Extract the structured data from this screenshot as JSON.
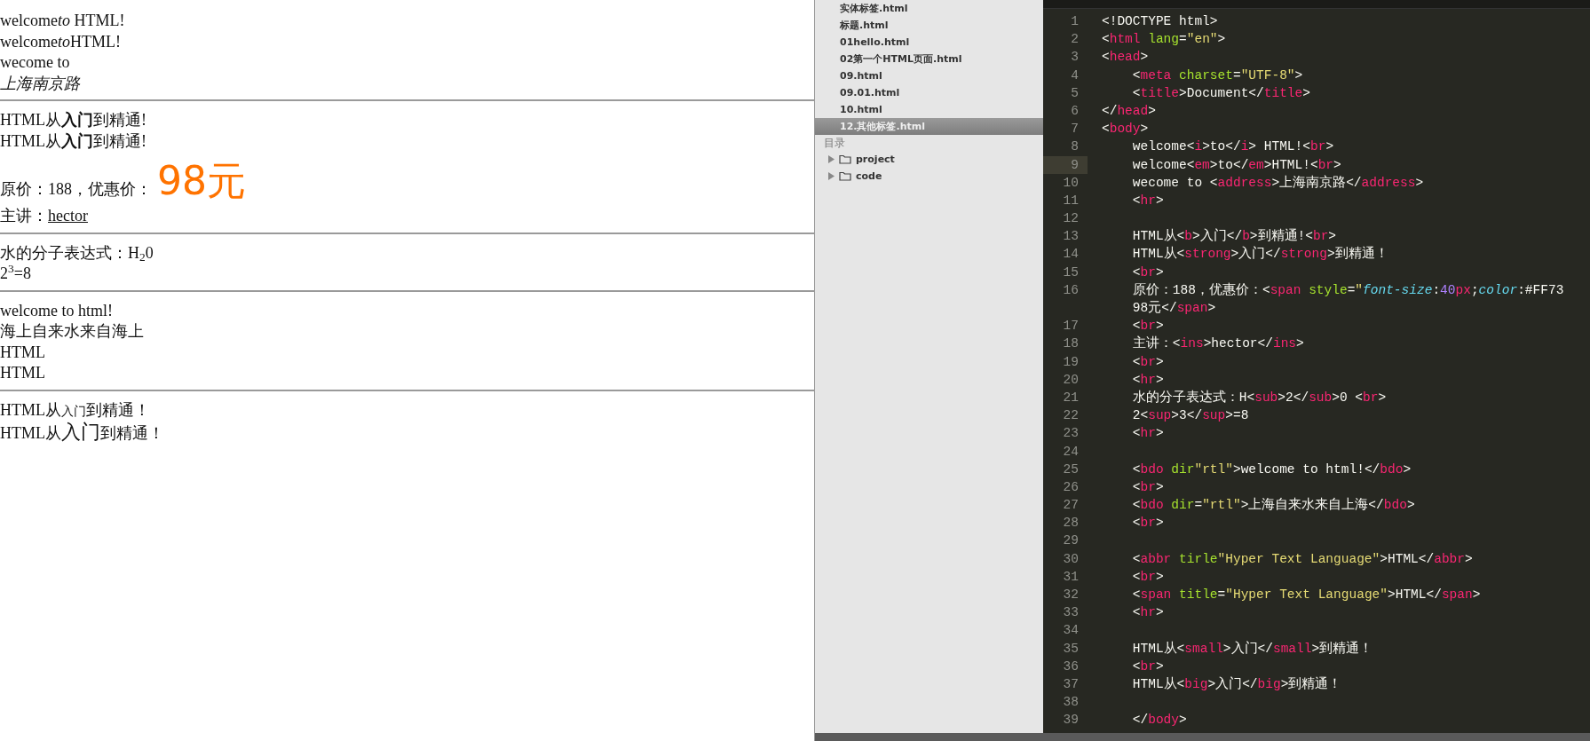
{
  "browser": {
    "sections": [
      {
        "lines": [
          {
            "kind": "parts",
            "parts": [
              {
                "kind": "plain",
                "text": "welcome"
              },
              {
                "kind": "italic",
                "text": "to"
              },
              {
                "kind": "plain",
                "text": " HTML!"
              }
            ]
          },
          {
            "kind": "parts",
            "parts": [
              {
                "kind": "plain",
                "text": "welcome"
              },
              {
                "kind": "italic",
                "text": "to"
              },
              {
                "kind": "plain",
                "text": "HTML!"
              }
            ]
          },
          {
            "kind": "text",
            "text": "wecome to"
          },
          {
            "kind": "address",
            "text": "上海南京路"
          }
        ]
      },
      {
        "lines": [
          {
            "kind": "text",
            "text": "HTML从**入门**到精通!"
          },
          {
            "kind": "text",
            "text": "HTML从**入门**到精通!"
          },
          {
            "kind": "price",
            "label": "原价：188，优惠价：",
            "price": "98元"
          },
          {
            "kind": "underline",
            "label": "主讲：",
            "value": "hector"
          }
        ]
      },
      {
        "lines": [
          {
            "kind": "text",
            "text": "水的分子表达式：H$_{2}$0"
          },
          {
            "kind": "text",
            "text": "2$^{3}$=8"
          }
        ]
      },
      {
        "lines": [
          {
            "kind": "text",
            "text": "welcome to html!"
          },
          {
            "kind": "text",
            "text": "海上自来水来自海上"
          },
          {
            "kind": "text",
            "text": "HTML"
          },
          {
            "kind": "text",
            "text": "HTML"
          }
        ]
      },
      {
        "lines": [
          {
            "kind": "parts",
            "parts": [
              {
                "kind": "plain",
                "text": "HTML从"
              },
              {
                "kind": "small",
                "text": "入门"
              },
              {
                "kind": "plain",
                "text": "到精通！"
              }
            ]
          },
          {
            "kind": "parts",
            "parts": [
              {
                "kind": "plain",
                "text": "HTML从"
              },
              {
                "kind": "big",
                "text": "入门"
              },
              {
                "kind": "plain",
                "text": "到精通！"
              }
            ]
          }
        ]
      }
    ]
  },
  "sidebar": {
    "files": [
      {
        "name": "实体标签.html",
        "selected": false
      },
      {
        "name": "标题.html",
        "selected": false
      },
      {
        "name": "01hello.html",
        "selected": false
      },
      {
        "name": "02第一个HTML页面.html",
        "selected": false
      },
      {
        "name": "09.html",
        "selected": false
      },
      {
        "name": "09.01.html",
        "selected": false
      },
      {
        "name": "10.html",
        "selected": false
      },
      {
        "name": "12.其他标签.html",
        "selected": true
      }
    ],
    "folders_heading": "目录",
    "folders": [
      {
        "name": "project",
        "expanded": false
      },
      {
        "name": "code",
        "expanded": false
      }
    ]
  },
  "editor": {
    "lines": [
      {
        "number": "1",
        "current": false,
        "tokens": [
          {
            "kind": "punct",
            "text": "<!DOCTYPE html>"
          }
        ]
      },
      {
        "number": "2",
        "current": false,
        "tokens": [
          {
            "kind": "punct",
            "text": "<"
          },
          {
            "kind": "tag",
            "text": "html"
          },
          {
            "kind": "attr",
            "text": " lang"
          },
          {
            "kind": "punct",
            "text": "="
          },
          {
            "kind": "string",
            "text": "\"en\""
          },
          {
            "kind": "punct",
            "text": ">"
          }
        ]
      },
      {
        "number": "3",
        "current": false,
        "tokens": [
          {
            "kind": "punct",
            "text": "<"
          },
          {
            "kind": "tag",
            "text": "head"
          },
          {
            "kind": "punct",
            "text": ">"
          }
        ]
      },
      {
        "number": "4",
        "current": false,
        "tokens": [
          {
            "kind": "punct",
            "text": "    <"
          },
          {
            "kind": "tag",
            "text": "meta"
          },
          {
            "kind": "attr",
            "text": " charset"
          },
          {
            "kind": "punct",
            "text": "="
          },
          {
            "kind": "string",
            "text": "\"UTF-8\""
          },
          {
            "kind": "punct",
            "text": ">"
          }
        ]
      },
      {
        "number": "5",
        "current": false,
        "tokens": [
          {
            "kind": "punct",
            "text": "    <"
          },
          {
            "kind": "tag",
            "text": "title"
          },
          {
            "kind": "punct",
            "text": ">Document</"
          },
          {
            "kind": "tag",
            "text": "title"
          },
          {
            "kind": "punct",
            "text": ">"
          }
        ]
      },
      {
        "number": "6",
        "current": false,
        "tokens": [
          {
            "kind": "punct",
            "text": "</"
          },
          {
            "kind": "tag",
            "text": "head"
          },
          {
            "kind": "punct",
            "text": ">"
          }
        ]
      },
      {
        "number": "7",
        "current": false,
        "tokens": [
          {
            "kind": "punct",
            "text": "<"
          },
          {
            "kind": "tag",
            "text": "body"
          },
          {
            "kind": "punct",
            "text": ">"
          }
        ]
      },
      {
        "number": "8",
        "current": false,
        "tokens": [
          {
            "kind": "punct",
            "text": "    welcome<"
          },
          {
            "kind": "tag",
            "text": "i"
          },
          {
            "kind": "punct",
            "text": ">to</"
          },
          {
            "kind": "tag",
            "text": "i"
          },
          {
            "kind": "punct",
            "text": "> HTML!<"
          },
          {
            "kind": "tag",
            "text": "br"
          },
          {
            "kind": "punct",
            "text": ">"
          }
        ]
      },
      {
        "number": "9",
        "current": true,
        "tokens": [
          {
            "kind": "punct",
            "text": "    welcome<"
          },
          {
            "kind": "tag",
            "text": "em"
          },
          {
            "kind": "punct",
            "text": ">to</"
          },
          {
            "kind": "tag",
            "text": "em"
          },
          {
            "kind": "punct",
            "text": ">HTML!<"
          },
          {
            "kind": "tag",
            "text": "br"
          },
          {
            "kind": "punct",
            "text": ">"
          }
        ]
      },
      {
        "number": "10",
        "current": false,
        "tokens": [
          {
            "kind": "punct",
            "text": "    wecome to <"
          },
          {
            "kind": "tag",
            "text": "address"
          },
          {
            "kind": "punct",
            "text": ">上海南京路</"
          },
          {
            "kind": "tag",
            "text": "address"
          },
          {
            "kind": "punct",
            "text": ">"
          }
        ]
      },
      {
        "number": "11",
        "current": false,
        "tokens": [
          {
            "kind": "punct",
            "text": "    <"
          },
          {
            "kind": "tag",
            "text": "hr"
          },
          {
            "kind": "punct",
            "text": ">"
          }
        ]
      },
      {
        "number": "12",
        "current": false
      },
      {
        "number": "13",
        "current": false,
        "tokens": [
          {
            "kind": "punct",
            "text": "    HTML从<"
          },
          {
            "kind": "tag",
            "text": "b"
          },
          {
            "kind": "punct",
            "text": ">入门</"
          },
          {
            "kind": "tag",
            "text": "b"
          },
          {
            "kind": "punct",
            "text": ">到精通!<"
          },
          {
            "kind": "tag",
            "text": "br"
          },
          {
            "kind": "punct",
            "text": ">"
          }
        ]
      },
      {
        "number": "14",
        "current": false,
        "tokens": [
          {
            "kind": "punct",
            "text": "    HTML从<"
          },
          {
            "kind": "tag",
            "text": "strong"
          },
          {
            "kind": "punct",
            "text": ">入门</"
          },
          {
            "kind": "tag",
            "text": "strong"
          },
          {
            "kind": "punct",
            "text": ">到精通！"
          }
        ]
      },
      {
        "number": "15",
        "current": false,
        "tokens": [
          {
            "kind": "punct",
            "text": "    <"
          },
          {
            "kind": "tag",
            "text": "br"
          },
          {
            "kind": "punct",
            "text": ">"
          }
        ]
      },
      {
        "number": "16",
        "current": false,
        "tokens": [
          {
            "kind": "punct",
            "text": "    原价：188，优惠价：<"
          },
          {
            "kind": "tag",
            "text": "span"
          },
          {
            "kind": "attr",
            "text": " style"
          },
          {
            "kind": "punct",
            "text": "="
          },
          {
            "kind": "string",
            "text": "\""
          },
          {
            "kind": "property",
            "text": "font-size"
          },
          {
            "kind": "punct",
            "text": ":"
          },
          {
            "kind": "number",
            "text": "40"
          },
          {
            "kind": "tag",
            "text": "px"
          },
          {
            "kind": "punct",
            "text": ";"
          },
          {
            "kind": "property",
            "text": "color"
          },
          {
            "kind": "punct",
            "text": ":#FF73"
          }
        ]
      },
      {
        "current": false,
        "tokens": [
          {
            "kind": "punct",
            "text": "    98元</"
          },
          {
            "kind": "tag",
            "text": "span"
          },
          {
            "kind": "punct",
            "text": ">"
          }
        ]
      },
      {
        "number": "17",
        "current": false,
        "tokens": [
          {
            "kind": "punct",
            "text": "    <"
          },
          {
            "kind": "tag",
            "text": "br"
          },
          {
            "kind": "punct",
            "text": ">"
          }
        ]
      },
      {
        "number": "18",
        "current": false,
        "tokens": [
          {
            "kind": "punct",
            "text": "    主讲：<"
          },
          {
            "kind": "tag",
            "text": "ins"
          },
          {
            "kind": "punct",
            "text": ">hector</"
          },
          {
            "kind": "tag",
            "text": "ins"
          },
          {
            "kind": "punct",
            "text": ">"
          }
        ]
      },
      {
        "number": "19",
        "current": false,
        "tokens": [
          {
            "kind": "punct",
            "text": "    <"
          },
          {
            "kind": "tag",
            "text": "br"
          },
          {
            "kind": "punct",
            "text": ">"
          }
        ]
      },
      {
        "number": "20",
        "current": false,
        "tokens": [
          {
            "kind": "punct",
            "text": "    <"
          },
          {
            "kind": "tag",
            "text": "hr"
          },
          {
            "kind": "punct",
            "text": ">"
          }
        ]
      },
      {
        "number": "21",
        "current": false,
        "tokens": [
          {
            "kind": "punct",
            "text": "    水的分子表达式：H<"
          },
          {
            "kind": "tag",
            "text": "sub"
          },
          {
            "kind": "punct",
            "text": ">2</"
          },
          {
            "kind": "tag",
            "text": "sub"
          },
          {
            "kind": "punct",
            "text": ">0 <"
          },
          {
            "kind": "tag",
            "text": "br"
          },
          {
            "kind": "punct",
            "text": ">"
          }
        ]
      },
      {
        "number": "22",
        "current": false,
        "tokens": [
          {
            "kind": "punct",
            "text": "    2<"
          },
          {
            "kind": "tag",
            "text": "sup"
          },
          {
            "kind": "punct",
            "text": ">3</"
          },
          {
            "kind": "tag",
            "text": "sup"
          },
          {
            "kind": "punct",
            "text": ">=8"
          }
        ]
      },
      {
        "number": "23",
        "current": false,
        "tokens": [
          {
            "kind": "punct",
            "text": "    <"
          },
          {
            "kind": "tag",
            "text": "hr"
          },
          {
            "kind": "punct",
            "text": ">"
          }
        ]
      },
      {
        "number": "24",
        "current": false
      },
      {
        "number": "25",
        "current": false,
        "tokens": [
          {
            "kind": "punct",
            "text": "    <"
          },
          {
            "kind": "tag",
            "text": "bdo"
          },
          {
            "kind": "attr",
            "text": " dir"
          },
          {
            "kind": "string",
            "text": "\"rtl\""
          },
          {
            "kind": "punct",
            "text": ">welcome to html!</"
          },
          {
            "kind": "tag",
            "text": "bdo"
          },
          {
            "kind": "punct",
            "text": ">"
          }
        ]
      },
      {
        "number": "26",
        "current": false,
        "tokens": [
          {
            "kind": "punct",
            "text": "    <"
          },
          {
            "kind": "tag",
            "text": "br"
          },
          {
            "kind": "punct",
            "text": ">"
          }
        ]
      },
      {
        "number": "27",
        "current": false,
        "tokens": [
          {
            "kind": "punct",
            "text": "    <"
          },
          {
            "kind": "tag",
            "text": "bdo"
          },
          {
            "kind": "attr",
            "text": " dir"
          },
          {
            "kind": "punct",
            "text": "="
          },
          {
            "kind": "string",
            "text": "\"rtl\""
          },
          {
            "kind": "punct",
            "text": ">上海自来水来自上海</"
          },
          {
            "kind": "tag",
            "text": "bdo"
          },
          {
            "kind": "punct",
            "text": ">"
          }
        ]
      },
      {
        "number": "28",
        "current": false,
        "tokens": [
          {
            "kind": "punct",
            "text": "    <"
          },
          {
            "kind": "tag",
            "text": "br"
          },
          {
            "kind": "punct",
            "text": ">"
          }
        ]
      },
      {
        "number": "29",
        "current": false
      },
      {
        "number": "30",
        "current": false,
        "tokens": [
          {
            "kind": "punct",
            "text": "    <"
          },
          {
            "kind": "tag",
            "text": "abbr"
          },
          {
            "kind": "attr",
            "text": " tirle"
          },
          {
            "kind": "string",
            "text": "\"Hyper Text Language\""
          },
          {
            "kind": "punct",
            "text": ">HTML</"
          },
          {
            "kind": "tag",
            "text": "abbr"
          },
          {
            "kind": "punct",
            "text": ">"
          }
        ]
      },
      {
        "number": "31",
        "current": false,
        "tokens": [
          {
            "kind": "punct",
            "text": "    <"
          },
          {
            "kind": "tag",
            "text": "br"
          },
          {
            "kind": "punct",
            "text": ">"
          }
        ]
      },
      {
        "number": "32",
        "current": false,
        "tokens": [
          {
            "kind": "punct",
            "text": "    <"
          },
          {
            "kind": "tag",
            "text": "span"
          },
          {
            "kind": "attr",
            "text": " title"
          },
          {
            "kind": "punct",
            "text": "="
          },
          {
            "kind": "string",
            "text": "\"Hyper Text Language\""
          },
          {
            "kind": "punct",
            "text": ">HTML</"
          },
          {
            "kind": "tag",
            "text": "span"
          },
          {
            "kind": "punct",
            "text": ">"
          }
        ]
      },
      {
        "number": "33",
        "current": false,
        "tokens": [
          {
            "kind": "punct",
            "text": "    <"
          },
          {
            "kind": "tag",
            "text": "hr"
          },
          {
            "kind": "punct",
            "text": ">"
          }
        ]
      },
      {
        "number": "34",
        "current": false
      },
      {
        "number": "35",
        "current": false,
        "tokens": [
          {
            "kind": "punct",
            "text": "    HTML从<"
          },
          {
            "kind": "tag",
            "text": "small"
          },
          {
            "kind": "punct",
            "text": ">入门</"
          },
          {
            "kind": "tag",
            "text": "small"
          },
          {
            "kind": "punct",
            "text": ">到精通！"
          }
        ]
      },
      {
        "number": "36",
        "current": false,
        "tokens": [
          {
            "kind": "punct",
            "text": "    <"
          },
          {
            "kind": "tag",
            "text": "br"
          },
          {
            "kind": "punct",
            "text": ">"
          }
        ]
      },
      {
        "number": "37",
        "current": false,
        "tokens": [
          {
            "kind": "punct",
            "text": "    HTML从<"
          },
          {
            "kind": "tag",
            "text": "big"
          },
          {
            "kind": "punct",
            "text": ">入门</"
          },
          {
            "kind": "tag",
            "text": "big"
          },
          {
            "kind": "punct",
            "text": ">到精通！"
          }
        ]
      },
      {
        "number": "38",
        "current": false
      },
      {
        "number": "39",
        "current": false,
        "tokens": [
          {
            "kind": "punct",
            "text": "    </"
          },
          {
            "kind": "tag",
            "text": "body"
          },
          {
            "kind": "punct",
            "text": ">"
          }
        ]
      }
    ]
  }
}
